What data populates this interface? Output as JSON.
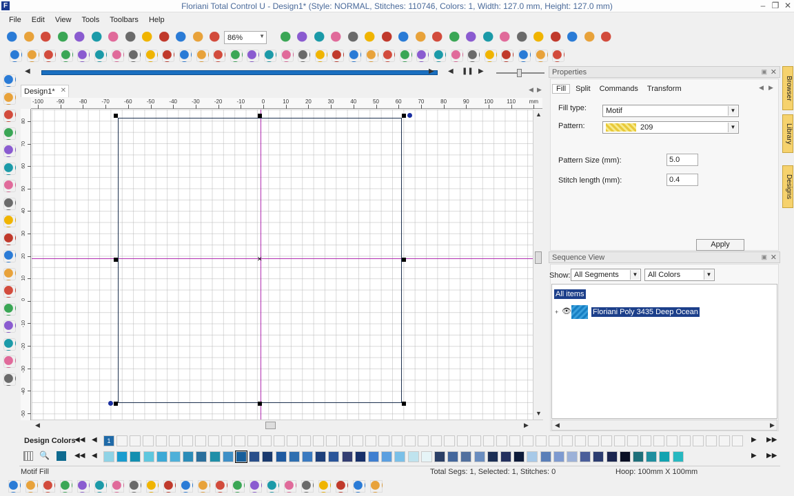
{
  "window": {
    "title": "Floriani Total Control U - Design1* (Style: NORMAL, Stitches: 110746, Colors: 1, Width: 127.0 mm, Height: 127.0 mm)",
    "minimize": "–",
    "maximize": "❐",
    "close": "✕"
  },
  "menu": [
    "File",
    "Edit",
    "View",
    "Tools",
    "Toolbars",
    "Help"
  ],
  "toolbar": {
    "zoom": "86%",
    "row1_icons": [
      "new-file-icon",
      "open-folder-icon",
      "save-icon",
      "save-as-icon",
      "print-icon",
      "cut-icon",
      "copy-icon",
      "paste-icon",
      "undo-icon",
      "redo-icon",
      "grid-icon",
      "settings-icon",
      "zoom-box",
      "f-icon",
      "needle-icon",
      "hoop-icon",
      "pen-icon",
      "line-icon",
      "sum-icon",
      "curve-icon",
      "shape-icon",
      "heart-icon",
      "dots-icon",
      "fill-icon",
      "flower-icon",
      "leaf-icon",
      "applique-icon",
      "tools-icon",
      "color-icon",
      "wand-icon",
      "magic-icon",
      "frame-icon",
      "monogram-icon",
      "user-icon"
    ],
    "row2_icons": [
      "text-icon",
      "script-icon",
      "monogram-text-icon",
      "multi-text-icon",
      "font-icon",
      "letter-icon",
      "applique-text-icon",
      "fire-icon",
      "split-icon",
      "transform-icon",
      "grid2-icon",
      "move-icon",
      "circle-color-icon",
      "star-node-icon",
      "shape-node-icon",
      "mirror-icon",
      "align-icon",
      "group-icon",
      "resize-icon",
      "rotate-icon",
      "nodes-icon",
      "select-all-icon",
      "flip-h-icon",
      "flip-v-icon",
      "rotate-left-icon",
      "rotate-right-icon",
      "center-icon",
      "arrange-icon",
      "copy-multi-icon",
      "paste-multi-icon",
      "layer-icon",
      "order-icon",
      "edit-icon"
    ]
  },
  "left_tools": [
    "select-icon",
    "node-select-icon",
    "reshape-icon",
    "pen-draw-icon",
    "zoom-icon",
    "measure-icon",
    "3d-icon",
    "pencil-icon",
    "image-icon",
    "grid-tool-icon",
    "hoop-tool-icon",
    "steps-icon",
    "fill-tool-icon",
    "connect-icon",
    "location-icon",
    "photo-icon",
    "stitch-icon",
    "camera-icon"
  ],
  "document": {
    "tab": "Design1*",
    "tab_close": "✕"
  },
  "ruler": {
    "top_labels": [
      "-100",
      "-90",
      "-80",
      "-70",
      "-60",
      "-50",
      "-40",
      "-30",
      "-20",
      "-10",
      "0",
      "10",
      "20",
      "30",
      "40",
      "50",
      "60",
      "70",
      "80",
      "90",
      "100",
      "110",
      "mm"
    ],
    "left_labels": [
      "80",
      "70",
      "60",
      "50",
      "40",
      "30",
      "20",
      "10",
      "0",
      "-10",
      "-20",
      "-30",
      "-40",
      "-50",
      "-60",
      "-70",
      "-80"
    ]
  },
  "properties": {
    "title": "Properties",
    "tabs": [
      "Fill",
      "Split",
      "Commands",
      "Transform"
    ],
    "fill_type_label": "Fill type:",
    "fill_type_value": "Motif",
    "pattern_label": "Pattern:",
    "pattern_value": "209",
    "pattern_size_label": "Pattern Size (mm):",
    "pattern_size_value": "5.0",
    "stitch_length_label": "Stitch length (mm):",
    "stitch_length_value": "0.4",
    "apply_label": "Apply"
  },
  "sequence": {
    "title": "Sequence View",
    "show_label": "Show:",
    "segments_filter": "All Segments",
    "colors_filter": "All Colors",
    "all_items": "All items",
    "item_label": "Floriani Poly 3435 Deep Ocean",
    "expand": "+"
  },
  "side_tabs": [
    "Browser",
    "Library",
    "Designs"
  ],
  "design_colors": {
    "label": "Design Colors",
    "slot_number": "1",
    "palette": [
      "#8fd3e6",
      "#1a9ccf",
      "#138fb0",
      "#5fc7de",
      "#3ca9d6",
      "#4fb0d9",
      "#2c8cb8",
      "#2b6f9c",
      "#1f8fa8",
      "#3e8fc6",
      "#175e9a",
      "#2a4f8a",
      "#1a3a6e",
      "#1f5aa0",
      "#2f6fb0",
      "#3a7ac0",
      "#1d3f7a",
      "#2a5599",
      "#333e72",
      "#17306a",
      "#3f7fd0",
      "#5b9fe0",
      "#7bc0e8",
      "#bfe3ee",
      "#e6f4f7",
      "#2b3f66",
      "#44679c",
      "#52709e",
      "#6a8dbf",
      "#1c2f55",
      "#24315e",
      "#0e1b3a",
      "#a7c9e8",
      "#5a7fb8",
      "#7e9ad0",
      "#9cb1d8",
      "#4a5e9a",
      "#2c3d70",
      "#1b2650",
      "#0a0f24",
      "#1e6f7a",
      "#1f8f9f",
      "#12a3b0",
      "#27b8c0"
    ]
  },
  "status": {
    "mode": "Motif Fill",
    "segments": "Total Segs: 1, Selected: 1, Stitches: 0",
    "hoop": "Hoop: 100mm X 100mm"
  },
  "bottom_tools": [
    "running-stitch-icon",
    "satin-icon",
    "fill-stitch-icon",
    "wave-fill-icon",
    "gradient-fill-icon",
    "contour-icon",
    "radial-icon",
    "spiral-icon",
    "cross-icon",
    "motif-star-icon",
    "star-fill-icon",
    "motif-fill-icon",
    "star-outline-icon",
    "wave-line-icon",
    "zigzag-icon",
    "zigzag2-icon",
    "zigzag3-icon",
    "leaf-fill-icon",
    "grass-icon",
    "weave-icon",
    "texture-icon",
    "star-burst-icon"
  ]
}
